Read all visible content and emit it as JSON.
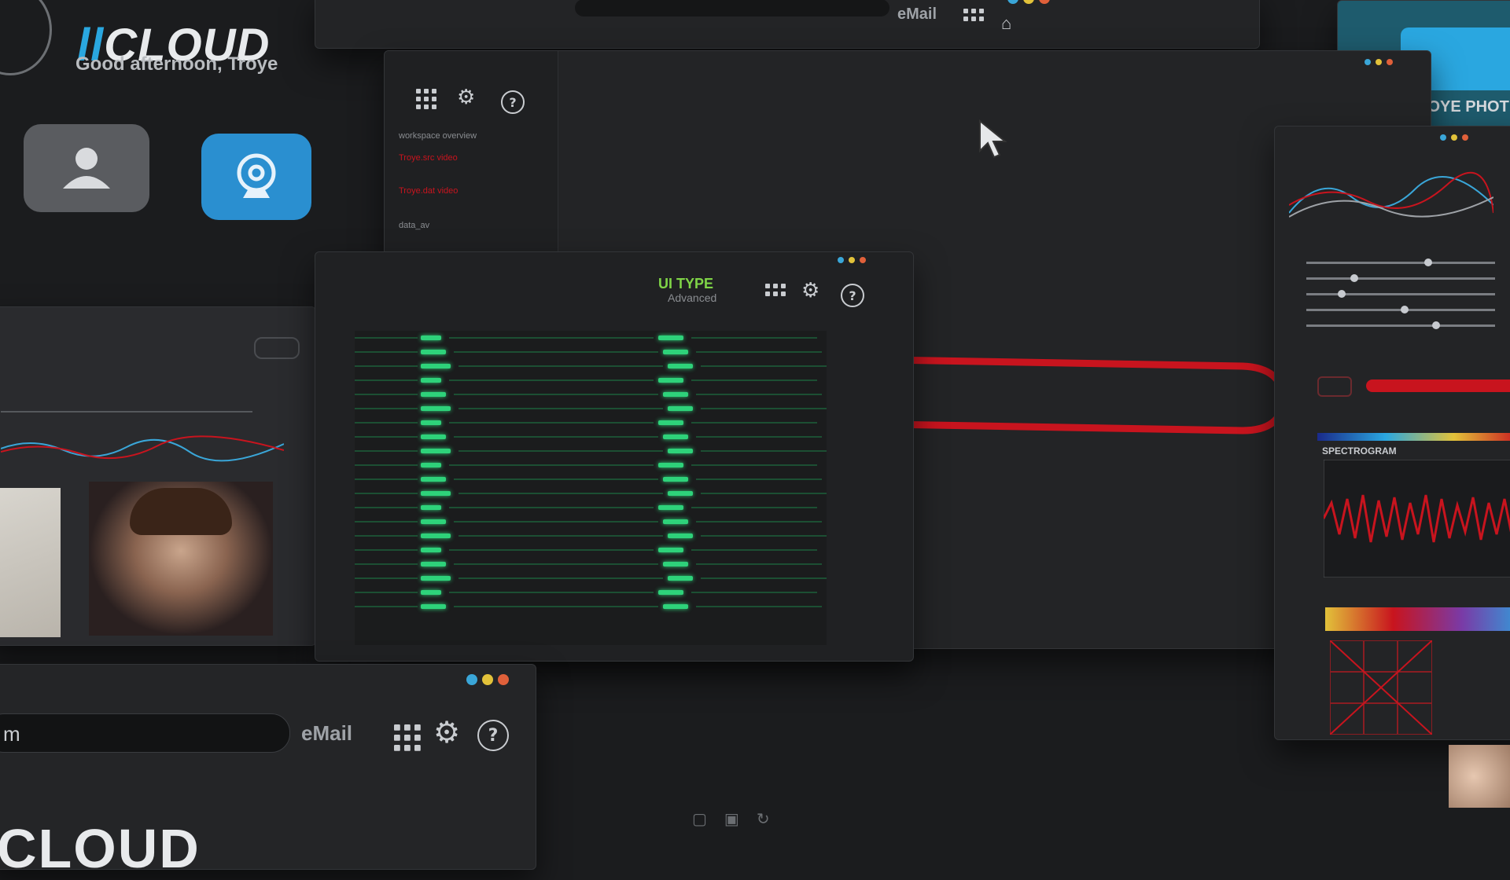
{
  "brand": {
    "logo_text": "CLOUD",
    "greeting": "Good afternoon, Troye",
    "bottom_logo_text": "CLOUD"
  },
  "settings_window": {
    "sidebar_items": [
      "workspace overview",
      "Troye.src video",
      "Troye.dat video",
      "data_av"
    ]
  },
  "terminal_window": {
    "ui_type_label": "UI TYPE",
    "ui_type_value": "Advanced"
  },
  "mail_bar": {
    "search_value": "m",
    "email_label": "eMail"
  },
  "top_bar": {
    "email_label": "eMail"
  },
  "photo_window": {
    "title": "ROYE PHOT"
  },
  "audio_panel": {
    "buttons": [
      "",
      ""
    ],
    "spectrogram_label": "SPECTROGRAM"
  },
  "colors": {
    "accent_green": "#2ed27a",
    "accent_red": "#c8141e",
    "accent_blue": "#2aa7e0",
    "dot_blue": "#3aa6d8",
    "dot_yellow": "#e2c23a",
    "dot_red": "#e0603a"
  },
  "icons": [
    "apps-grid-icon",
    "gear-icon",
    "help-icon",
    "user-icon",
    "webcam-icon",
    "cursor-icon",
    "home-icon",
    "star-icon",
    "folder-icon"
  ]
}
